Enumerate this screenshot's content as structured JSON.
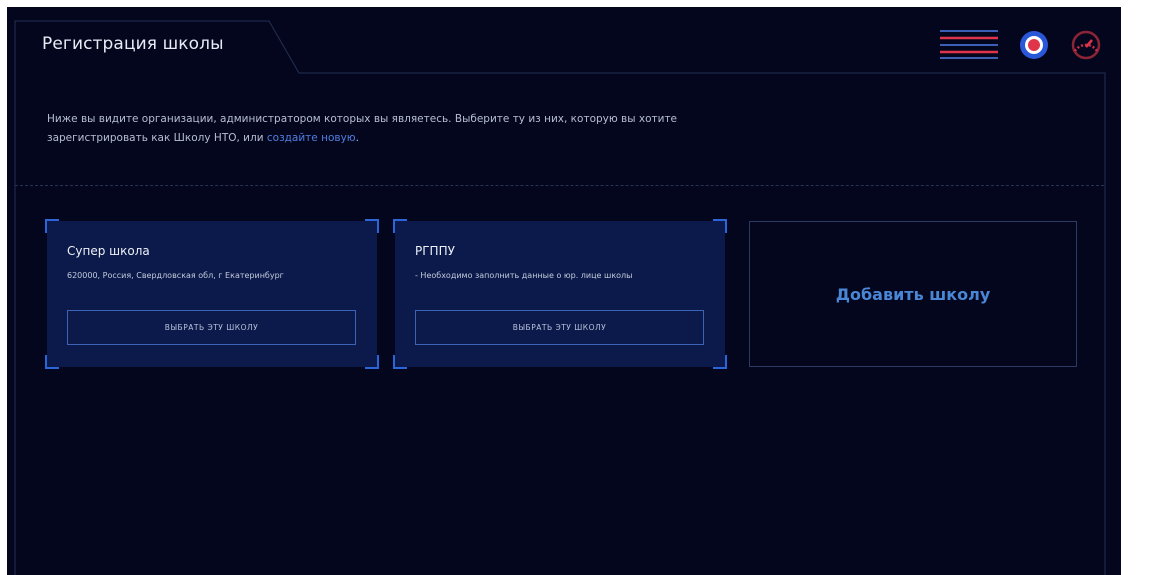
{
  "header": {
    "title": "Регистрация школы",
    "icons": [
      "menu-icon",
      "target-icon",
      "gauge-icon"
    ]
  },
  "intro": {
    "text": "Ниже вы видите организации, администратором которых вы являетесь. Выберите ту из них, которую вы хотите зарегистрировать как Школу НТО, или ",
    "link_text": "создайте новую",
    "suffix": "."
  },
  "schools": [
    {
      "name": "Супер школа",
      "address": "620000, Россия, Свердловская обл, г Екатеринбург",
      "button_label": "ВЫБРАТЬ ЭТУ ШКОЛУ"
    },
    {
      "name": "РГППУ",
      "address": "- Необходимо заполнить данные о юр. лице школы",
      "button_label": "ВЫБРАТЬ ЭТУ ШКОЛУ"
    }
  ],
  "add_school": {
    "label": "Добавить школу"
  },
  "colors": {
    "background": "#04061d",
    "card": "#0b1a4a",
    "accent_blue": "#2c65d8",
    "link": "#4f7fe0",
    "accent_red": "#e0344a"
  }
}
